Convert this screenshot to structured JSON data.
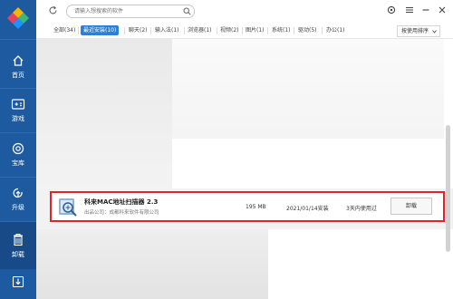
{
  "window": {
    "search_placeholder": "请输入想搜索的软件"
  },
  "sidebar": {
    "items": [
      {
        "label": "首页",
        "icon": "home-icon"
      },
      {
        "label": "游戏",
        "icon": "gamepad-icon"
      },
      {
        "label": "宝库",
        "icon": "treasure-icon"
      },
      {
        "label": "升级",
        "icon": "upgrade-icon"
      },
      {
        "label": "卸载",
        "icon": "trash-icon",
        "active": true
      },
      {
        "label": "",
        "icon": "download-icon"
      }
    ]
  },
  "tabs": [
    {
      "label": "全部(34)"
    },
    {
      "label": "最近安装(10)",
      "active": true
    },
    {
      "label": "聊天(2)"
    },
    {
      "label": "输入法(1)"
    },
    {
      "label": "浏览器(1)"
    },
    {
      "label": "视频(2)"
    },
    {
      "label": "图片(1)"
    },
    {
      "label": "系统(1)"
    },
    {
      "label": "驱动(5)"
    },
    {
      "label": "办公(1)"
    }
  ],
  "sort": {
    "label": "按使用排序"
  },
  "app": {
    "name": "科来MAC地址扫描器 2.3",
    "publisher": "出品公司：成都科来软件有限公司",
    "size": "195 MB",
    "install_date": "2021/01/14安装",
    "usage": "3天内使用过",
    "uninstall_label": "卸载"
  },
  "colors": {
    "sidebar": "#1e5aa0",
    "accent": "#2c7fd6",
    "highlight_border": "#e2232a"
  }
}
